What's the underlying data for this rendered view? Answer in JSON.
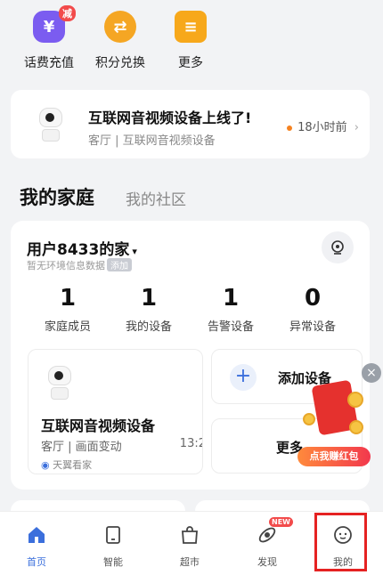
{
  "quick_services": [
    {
      "label": "话费充值",
      "icon": "phone-recharge-icon",
      "badge": "减",
      "color": "#7b5cf0"
    },
    {
      "label": "积分兑换",
      "icon": "exchange-icon",
      "color": "#f5a623"
    },
    {
      "label": "更多",
      "icon": "more-list-icon",
      "color": "#f7a81b"
    }
  ],
  "notice": {
    "title": "互联网音视频设备上线了!",
    "subtitle": "客厅 | 互联网音视频设备",
    "time": "18小时前"
  },
  "tabs": {
    "home": "我的家庭",
    "community": "我的社区"
  },
  "family": {
    "name": "用户8433的家",
    "env_text": "暂无环境信息数据",
    "env_tag": "添加",
    "stats": [
      {
        "value": "1",
        "label": "家庭成员"
      },
      {
        "value": "1",
        "label": "我的设备"
      },
      {
        "value": "1",
        "label": "告警设备"
      },
      {
        "value": "0",
        "label": "异常设备"
      }
    ]
  },
  "device": {
    "name": "互联网音视频设备",
    "status": "客厅 | 画面变动",
    "time": "13:2",
    "source": "天翼看家"
  },
  "add_device_label": "添加设备",
  "more_label": "更多",
  "promo": {
    "text": "点我赚红包"
  },
  "tabbar": [
    {
      "label": "首页",
      "icon": "home-icon",
      "active": true
    },
    {
      "label": "智能",
      "icon": "tablet-icon"
    },
    {
      "label": "超市",
      "icon": "shopping-bag-icon"
    },
    {
      "label": "发现",
      "icon": "discover-icon",
      "badge": "NEW"
    },
    {
      "label": "我的",
      "icon": "profile-face-icon"
    }
  ],
  "colors": {
    "accent": "#3b6fdc",
    "highlight": "#e52222"
  }
}
